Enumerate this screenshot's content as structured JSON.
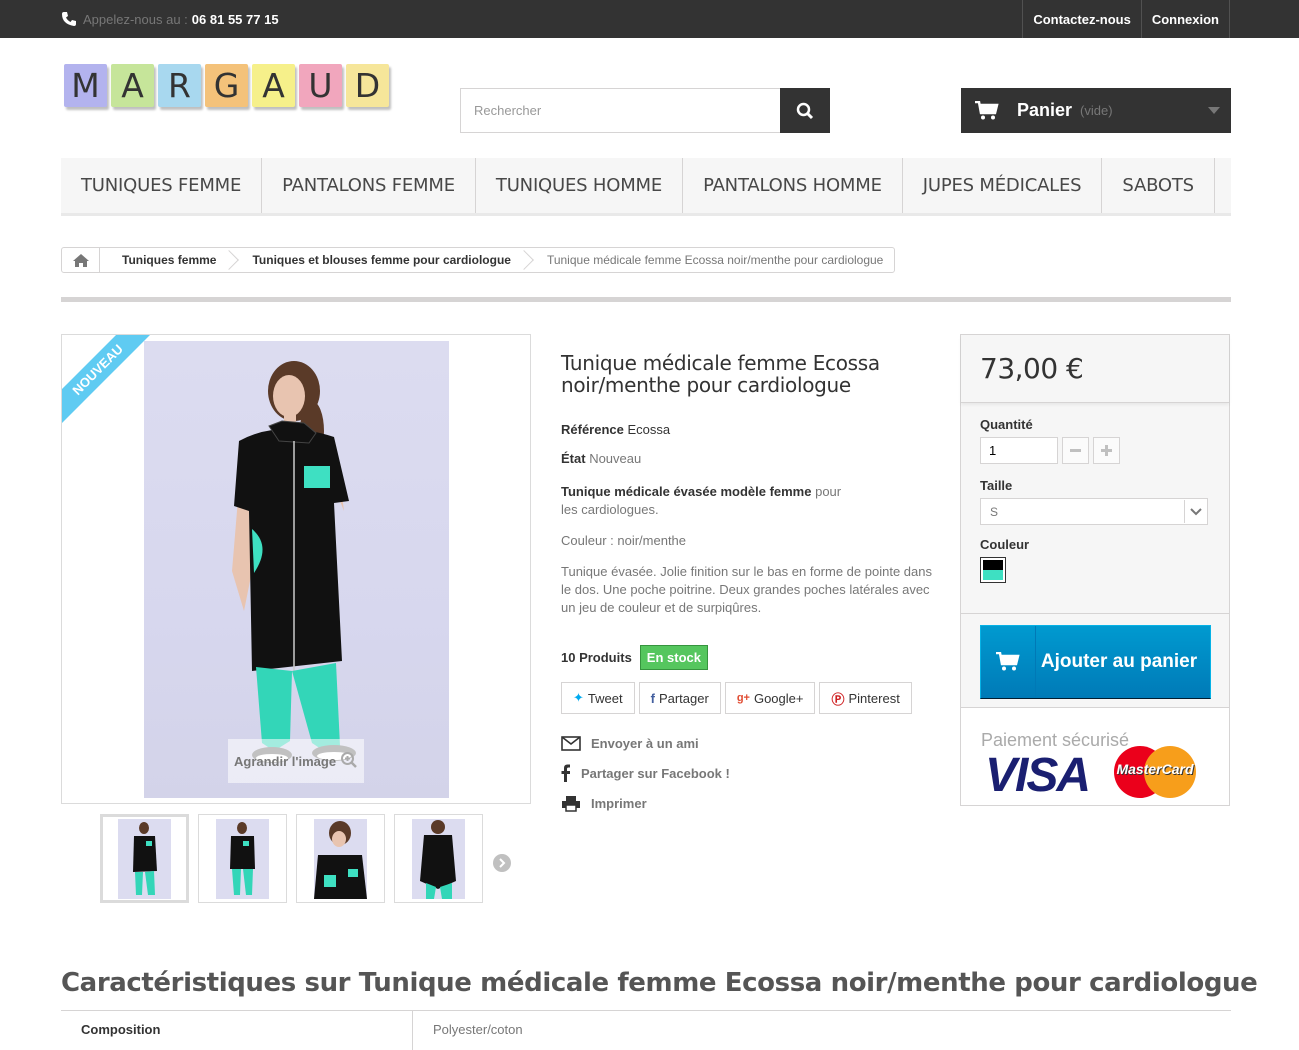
{
  "topbar": {
    "call_label": "Appelez-nous au :",
    "phone": "06 81 55 77 15",
    "contact": "Contactez-nous",
    "login": "Connexion"
  },
  "logo": {
    "letters": [
      "M",
      "A",
      "R",
      "G",
      "A",
      "U",
      "D"
    ],
    "colors": [
      "#b3b3ee",
      "#c6e59a",
      "#a8d8ef",
      "#f4c27a",
      "#f6f08a",
      "#f1a6bd",
      "#f6e69a"
    ]
  },
  "search": {
    "placeholder": "Rechercher",
    "icon": "search-icon"
  },
  "cart": {
    "label": "Panier",
    "status": "(vide)"
  },
  "menu": [
    "TUNIQUES FEMME",
    "PANTALONS FEMME",
    "TUNIQUES HOMME",
    "PANTALONS HOMME",
    "JUPES MÉDICALES",
    "SABOTS"
  ],
  "breadcrumb": [
    "Tuniques femme",
    "Tuniques et blouses femme pour cardiologue",
    "Tunique médicale femme Ecossa noir/menthe pour cardiologue"
  ],
  "image": {
    "ribbon": "Nouveau",
    "enlarge": "Agrandir l'image"
  },
  "product": {
    "title": "Tunique médicale femme Ecossa noir/menthe pour cardiologue",
    "ref_label": "Référence",
    "ref_value": "Ecossa",
    "state_label": "État",
    "state_value": "Nouveau",
    "desc_bold": "Tunique médicale évasée modèle femme",
    "desc_rest": " pour les cardiologues.",
    "color_line": "Couleur : noir/menthe",
    "details": "Tunique évasée. Jolie finition sur le bas en forme de pointe dans le dos. Une poche poitrine. Deux grandes poches latérales avec un jeu de couleur et de surpiqûres.",
    "quantity_text": "10 Produits",
    "stock_badge": "En stock"
  },
  "social": [
    "Tweet",
    "Partager",
    "Google+",
    "Pinterest"
  ],
  "actions": [
    "Envoyer à un ami",
    "Partager sur Facebook !",
    "Imprimer"
  ],
  "buy": {
    "price": "73,00 €",
    "qty_label": "Quantité",
    "qty_value": "1",
    "size_label": "Taille",
    "size_value": "S",
    "color_label": "Couleur",
    "add_to_cart": "Ajouter au panier",
    "secure_payment": "Paiement sécurisé",
    "visa": "VISA",
    "mastercard": "MasterCard"
  },
  "characteristics": {
    "title": "Caractéristiques sur Tunique médicale femme Ecossa noir/menthe pour cardiologue",
    "rows": [
      {
        "name": "Composition",
        "value": "Polyester/coton"
      }
    ]
  },
  "colors": {
    "accent_green": "#55c65e",
    "cart_blue": "#009ad0",
    "ribbon": "#5fcbf2",
    "mint": "#3ee0c2"
  }
}
